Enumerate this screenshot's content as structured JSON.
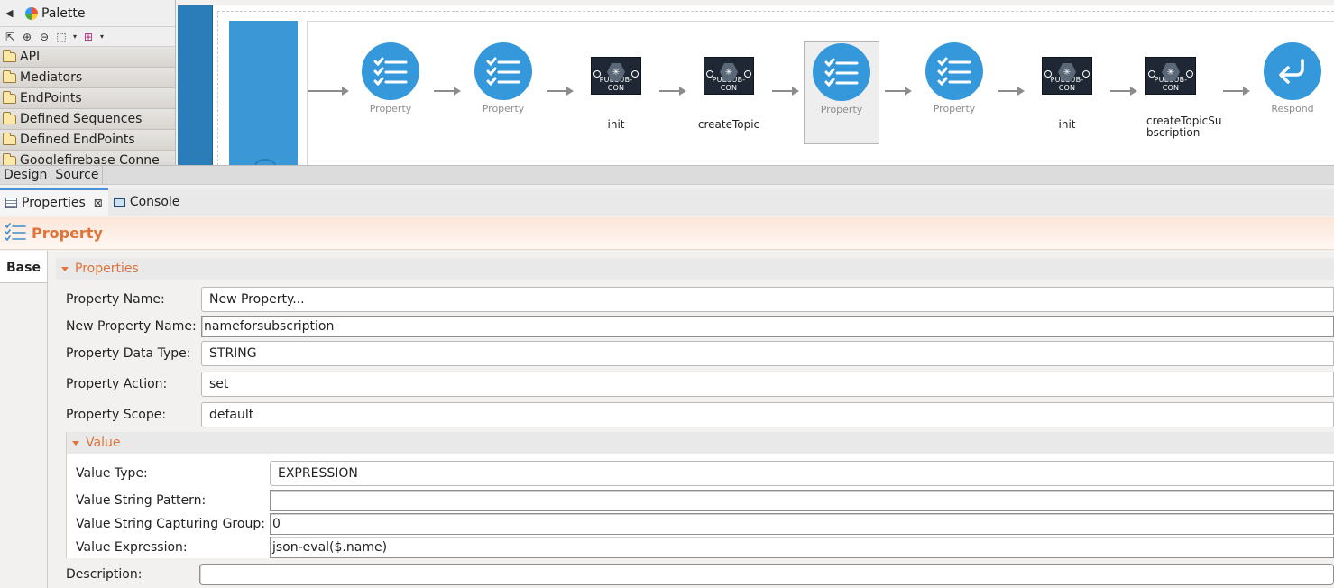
{
  "palette": {
    "title": "Palette",
    "drawers": [
      "API",
      "Mediators",
      "EndPoints",
      "Defined Sequences",
      "Defined EndPoints",
      "Googlefirebase Conne"
    ]
  },
  "canvas": {
    "mediators": [
      {
        "kind": "property",
        "label": "Property"
      },
      {
        "kind": "property",
        "label": "Property"
      },
      {
        "kind": "connector",
        "badge": "PUBSUB-CON",
        "label": "init"
      },
      {
        "kind": "connector",
        "badge": "PUBSUB-CON",
        "label": "createTopic"
      },
      {
        "kind": "property",
        "label": "Property",
        "selected": true
      },
      {
        "kind": "property",
        "label": "Property"
      },
      {
        "kind": "connector",
        "badge": "PUBSUB-CON",
        "label": "init"
      },
      {
        "kind": "connector",
        "badge": "PUBSUB-CON",
        "label": "createTopicSu\nbscription"
      },
      {
        "kind": "respond",
        "label": "Respond"
      }
    ]
  },
  "editor_tabs": {
    "design": "Design",
    "source": "Source"
  },
  "views": {
    "properties": "Properties",
    "console": "Console"
  },
  "property_header": {
    "title": "Property"
  },
  "base_tab": "Base",
  "form": {
    "section_title": "Properties",
    "property_name_label": "Property Name:",
    "property_name_value": "New Property...",
    "new_property_name_label": "New Property Name:",
    "new_property_name_value": "nameforsubscription",
    "data_type_label": "Property Data Type:",
    "data_type_value": "STRING",
    "action_label": "Property Action:",
    "action_value": "set",
    "scope_label": "Property Scope:",
    "scope_value": "default",
    "value_section_title": "Value",
    "value_type_label": "Value Type:",
    "value_type_value": "EXPRESSION",
    "string_pattern_label": "Value String Pattern:",
    "string_pattern_value": "",
    "capturing_group_label": "Value String Capturing Group:",
    "capturing_group_value": "0",
    "expression_label": "Value Expression:",
    "expression_value": "json-eval($.name)",
    "description_label": "Description:",
    "description_value": ""
  },
  "colors": {
    "accent": "#e0733a",
    "mediator_blue": "#3498db",
    "frame_blue": "#2a7db8"
  }
}
